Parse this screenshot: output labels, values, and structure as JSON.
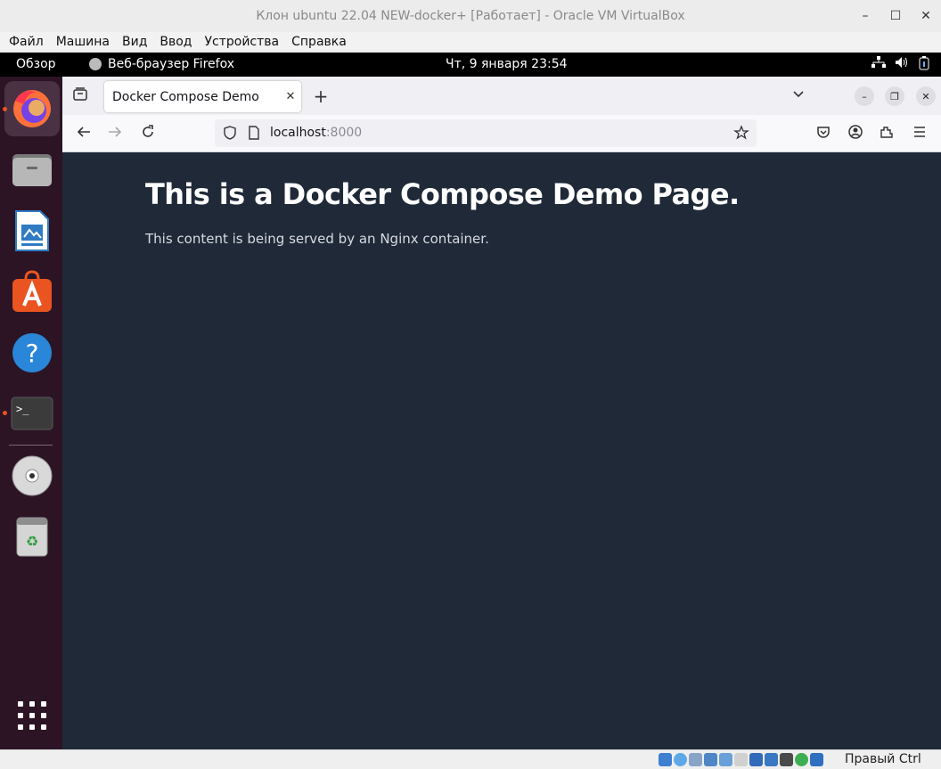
{
  "vbox": {
    "title": "Клон ubuntu 22.04 NEW-docker+ [Работает] - Oracle VM VirtualBox",
    "menu": [
      "Файл",
      "Машина",
      "Вид",
      "Ввод",
      "Устройства",
      "Справка"
    ],
    "host_key": "Правый Ctrl"
  },
  "gnome": {
    "overview": "Обзор",
    "active_app": "Веб-браузер Firefox",
    "clock": "Чт, 9 января  23:54"
  },
  "dock": {
    "items": [
      "firefox",
      "files",
      "libreoffice-writer",
      "app-center",
      "help",
      "terminal",
      "dvd",
      "trash",
      "show-apps"
    ]
  },
  "browser": {
    "tab_title": "Docker Compose Demo",
    "url_host": "localhost",
    "url_port": ":8000"
  },
  "page": {
    "heading": "This is a Docker Compose Demo Page.",
    "text": "This content is being served by an Nginx container."
  },
  "colors": {
    "page_bg": "#1f2937",
    "dock_bg": "#2c1425",
    "ubuntu_orange": "#e95420"
  }
}
